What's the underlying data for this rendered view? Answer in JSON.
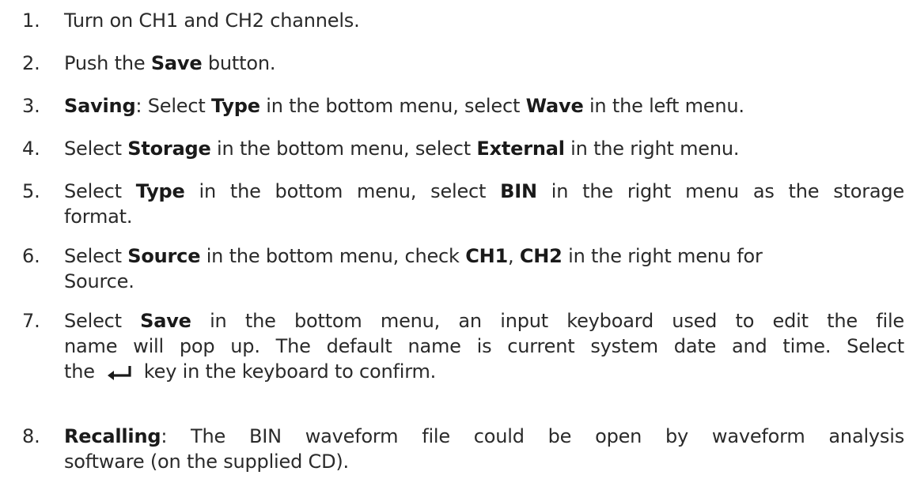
{
  "steps": [
    {
      "num": "1.",
      "parts": {
        "t1": "Turn on CH1 and CH2 channels."
      }
    },
    {
      "num": "2.",
      "parts": {
        "t1": "Push the ",
        "b1": "Save",
        "t2": " button."
      }
    },
    {
      "num": "3.",
      "parts": {
        "b1": "Saving",
        "t1": ": Select ",
        "b2": "Type",
        "t2": " in the bottom menu, select ",
        "b3": "Wave",
        "t3": " in the left menu."
      }
    },
    {
      "num": "4.",
      "parts": {
        "t1": "Select ",
        "b1": "Storage",
        "t2": " in the bottom menu, select ",
        "b2": "External",
        "t3": " in the right menu."
      }
    },
    {
      "num": "5.",
      "parts": {
        "t1": "Select ",
        "b1": "Type",
        "t2": " in the bottom menu, select ",
        "b2": "BIN",
        "t3": " in the right menu as the storage",
        "t4": "format."
      }
    },
    {
      "num": "6.",
      "parts": {
        "t1": "Select ",
        "b1": "Source",
        "t2": " in the bottom menu, check ",
        "b2": "CH1",
        "t3": ", ",
        "b3": "CH2",
        "t4": " in the right menu for",
        "t5": "Source."
      }
    },
    {
      "num": "7.",
      "parts": {
        "t1": "Select ",
        "b1": "Save",
        "t2": " in the bottom menu, an input keyboard used to edit the file",
        "t3": "name will pop up. The default name is current system date and time. Select",
        "t4": "the",
        "t5": "key in the keyboard to confirm."
      }
    },
    {
      "num": "8.",
      "parts": {
        "b1": "Recalling",
        "t1": ": The BIN waveform file could be open by waveform analysis",
        "t2": "software (on the supplied CD)."
      }
    }
  ]
}
